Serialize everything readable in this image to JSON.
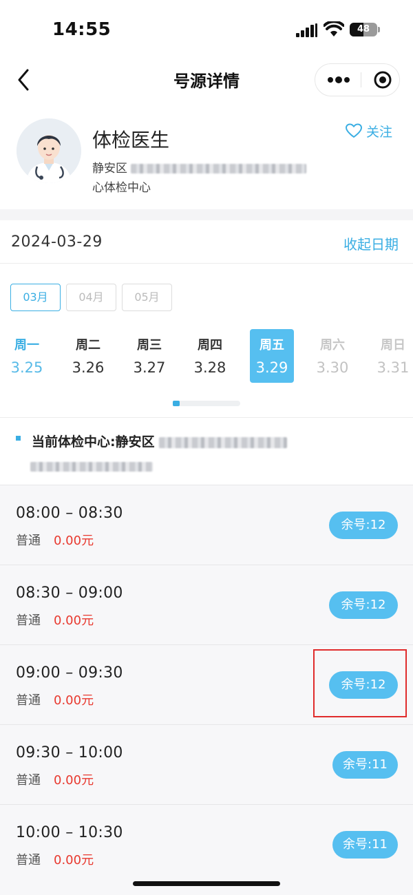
{
  "status_bar": {
    "time": "14:55",
    "battery": "48"
  },
  "nav": {
    "title": "号源详情"
  },
  "doctor": {
    "name": "体检医生",
    "address_prefix": "静安区",
    "address_suffix": "心体检中心",
    "follow_label": "关注"
  },
  "date_header": {
    "current_date": "2024-03-29",
    "collapse_label": "收起日期"
  },
  "months": [
    {
      "label": "03月",
      "active": true
    },
    {
      "label": "04月",
      "active": false
    },
    {
      "label": "05月",
      "active": false
    }
  ],
  "days": [
    {
      "weekday": "周一",
      "date": "3.25",
      "state": "today"
    },
    {
      "weekday": "周二",
      "date": "3.26",
      "state": "normal"
    },
    {
      "weekday": "周三",
      "date": "3.27",
      "state": "normal"
    },
    {
      "weekday": "周四",
      "date": "3.28",
      "state": "normal"
    },
    {
      "weekday": "周五",
      "date": "3.29",
      "state": "selected"
    },
    {
      "weekday": "周六",
      "date": "3.30",
      "state": "disabled"
    },
    {
      "weekday": "周日",
      "date": "3.31",
      "state": "disabled"
    }
  ],
  "center": {
    "title_prefix": "当前体检中心:静安区"
  },
  "slots": [
    {
      "time": "08:00 – 08:30",
      "type": "普通",
      "price": "0.00元",
      "remaining": "余号:12"
    },
    {
      "time": "08:30 – 09:00",
      "type": "普通",
      "price": "0.00元",
      "remaining": "余号:12"
    },
    {
      "time": "09:00 – 09:30",
      "type": "普通",
      "price": "0.00元",
      "remaining": "余号:12"
    },
    {
      "time": "09:30 – 10:00",
      "type": "普通",
      "price": "0.00元",
      "remaining": "余号:11"
    },
    {
      "time": "10:00 – 10:30",
      "type": "普通",
      "price": "0.00元",
      "remaining": "余号:11"
    }
  ],
  "colors": {
    "accent": "#3aaee3",
    "pill": "#56bff0",
    "price": "#e8392f",
    "highlight": "#e02b2b"
  }
}
